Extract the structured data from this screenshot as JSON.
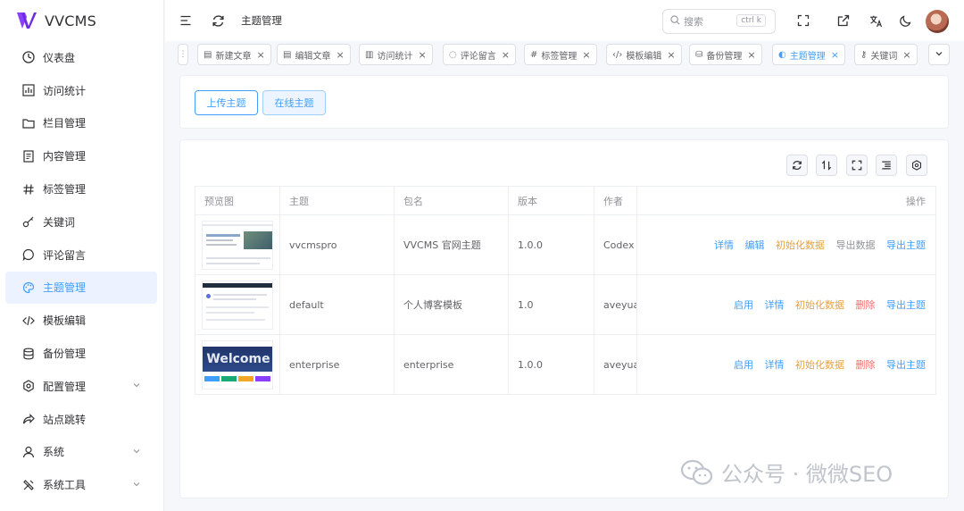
{
  "app": {
    "name": "VVCMS",
    "brand_color": "#8a3ffc",
    "accent": "#409eff"
  },
  "sidebar": {
    "items": [
      {
        "label": "仪表盘",
        "icon": "dashboard-icon"
      },
      {
        "label": "访问统计",
        "icon": "bar-chart-icon"
      },
      {
        "label": "栏目管理",
        "icon": "folder-icon"
      },
      {
        "label": "内容管理",
        "icon": "document-icon"
      },
      {
        "label": "标签管理",
        "icon": "hashtag-icon"
      },
      {
        "label": "关键词",
        "icon": "key-icon"
      },
      {
        "label": "评论留言",
        "icon": "comment-icon"
      },
      {
        "label": "主题管理",
        "icon": "palette-icon",
        "active": true
      },
      {
        "label": "模板编辑",
        "icon": "code-icon"
      },
      {
        "label": "备份管理",
        "icon": "database-icon"
      },
      {
        "label": "配置管理",
        "icon": "gear-icon",
        "expandable": true
      },
      {
        "label": "站点跳转",
        "icon": "redirect-icon"
      },
      {
        "label": "系统",
        "icon": "user-icon",
        "expandable": true
      },
      {
        "label": "系统工具",
        "icon": "tools-icon",
        "expandable": true
      }
    ]
  },
  "header": {
    "breadcrumb": "主题管理",
    "search": {
      "placeholder": "搜索",
      "shortcut": "ctrl k"
    }
  },
  "tabs": [
    {
      "label": "新建文章",
      "icon": "document-icon"
    },
    {
      "label": "编辑文章",
      "icon": "document-icon"
    },
    {
      "label": "访问统计",
      "icon": "bar-chart-icon"
    },
    {
      "label": "评论留言",
      "icon": "comment-icon"
    },
    {
      "label": "标签管理",
      "icon": "hashtag-icon"
    },
    {
      "label": "模板编辑",
      "icon": "code-icon"
    },
    {
      "label": "备份管理",
      "icon": "database-icon"
    },
    {
      "label": "主题管理",
      "icon": "palette-icon",
      "active": true
    },
    {
      "label": "关键词",
      "icon": "key-icon"
    }
  ],
  "actions": {
    "upload": "上传主题",
    "online": "在线主题"
  },
  "table": {
    "headers": [
      "预览图",
      "主题",
      "包名",
      "版本",
      "作者",
      "操作"
    ],
    "rows": [
      {
        "theme": "vvcmspro",
        "package": "VVCMS 官网主题",
        "version": "1.0.0",
        "author": "Codex",
        "ops": [
          {
            "label": "详情",
            "color": "blue"
          },
          {
            "label": "编辑",
            "color": "blue"
          },
          {
            "label": "初始化数据",
            "color": "orange"
          },
          {
            "label": "导出数据",
            "color": "gray"
          },
          {
            "label": "导出主题",
            "color": "blue"
          }
        ]
      },
      {
        "theme": "default",
        "package": "个人博客模板",
        "version": "1.0",
        "author": "aveyuan",
        "ops": [
          {
            "label": "启用",
            "color": "blue"
          },
          {
            "label": "详情",
            "color": "blue"
          },
          {
            "label": "初始化数据",
            "color": "orange"
          },
          {
            "label": "删除",
            "color": "red"
          },
          {
            "label": "导出主题",
            "color": "blue"
          }
        ]
      },
      {
        "theme": "enterprise",
        "package": "enterprise",
        "version": "1.0.0",
        "author": "aveyuan",
        "preview_text": "Welcome",
        "ops": [
          {
            "label": "启用",
            "color": "blue"
          },
          {
            "label": "详情",
            "color": "blue"
          },
          {
            "label": "初始化数据",
            "color": "orange"
          },
          {
            "label": "删除",
            "color": "red"
          },
          {
            "label": "导出主题",
            "color": "blue"
          }
        ]
      }
    ]
  },
  "watermark": {
    "text": "公众号 · 微微SEO"
  }
}
